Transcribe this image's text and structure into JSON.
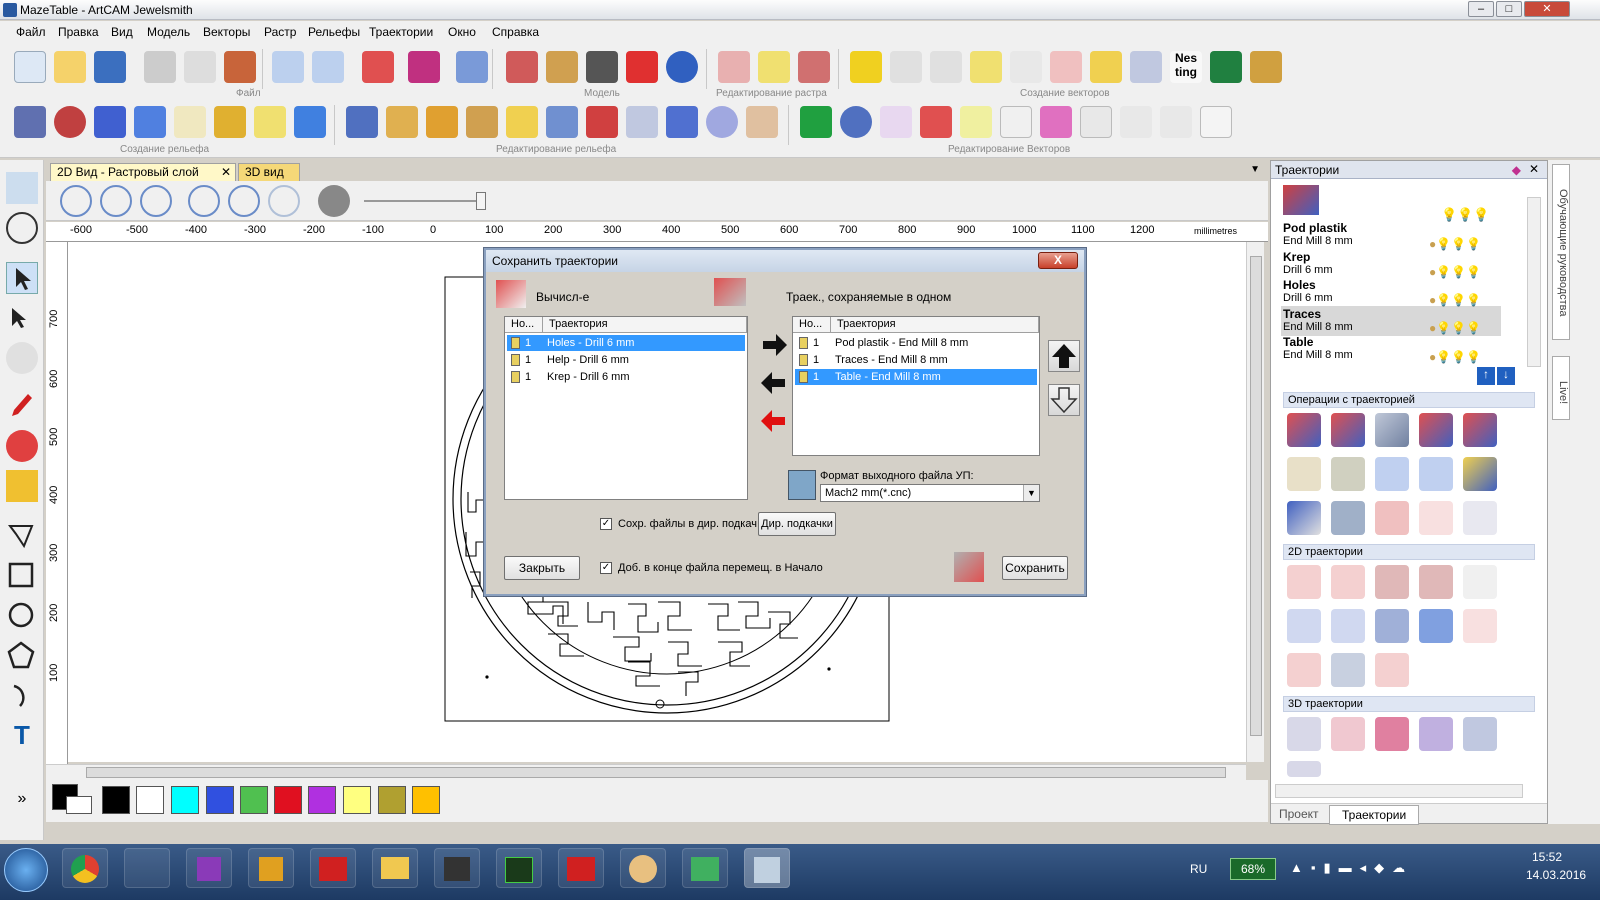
{
  "window": {
    "title": "MazeTable - ArtCAM Jewelsmith"
  },
  "menu": [
    "Файл",
    "Правка",
    "Вид",
    "Модель",
    "Векторы",
    "Растр",
    "Рельефы",
    "Траектории",
    "Окно",
    "Справка"
  ],
  "toolbar_groups": {
    "file": "Файл",
    "model": "Модель",
    "raster": "Редактирование растра",
    "vector_create": "Создание векторов",
    "relief_create": "Создание рельефа",
    "relief_edit": "Редактирование рельефа",
    "vector_edit": "Редактирование Векторов"
  },
  "tabs": [
    {
      "label": "2D Вид - Растровый слой",
      "active": true
    },
    {
      "label": "3D вид",
      "active": false
    }
  ],
  "ruler": {
    "ticks": [
      "-600",
      "-500",
      "-400",
      "-300",
      "-200",
      "-100",
      "0",
      "100",
      "200",
      "300",
      "400",
      "500",
      "600",
      "700",
      "800",
      "900",
      "1000",
      "1100",
      "1200"
    ],
    "unit": "millimetres",
    "vticks": [
      "700",
      "600",
      "500",
      "400",
      "300",
      "200",
      "100"
    ]
  },
  "palette": [
    "#000000",
    "#ffffff",
    "#00ffff",
    "#3050e0",
    "#50c050",
    "#e01020",
    "#b030e0",
    "#ffff80",
    "#b0a030",
    "#ffc000"
  ],
  "dialog": {
    "title": "Сохранить траектории",
    "left_label": "Вычисл-е",
    "right_label": "Траек., сохраняемые в одном",
    "col_no": "Но...",
    "col_name": "Траектория",
    "left_rows": [
      {
        "no": "1",
        "name": "Holes - Drill 6 mm",
        "selected": true
      },
      {
        "no": "1",
        "name": "Help - Drill 6 mm",
        "selected": false
      },
      {
        "no": "1",
        "name": "Krep - Drill 6 mm",
        "selected": false
      }
    ],
    "right_rows": [
      {
        "no": "1",
        "name": "Pod plastik - End Mill 8 mm",
        "selected": false
      },
      {
        "no": "1",
        "name": "Traces - End Mill 8 mm",
        "selected": false
      },
      {
        "no": "1",
        "name": "Table - End Mill 8 mm",
        "selected": true
      }
    ],
    "format_label": "Формат выходного файла УП:",
    "format_value": "Mach2 mm(*.cnc)",
    "chk_save_dir": "Сохр. файлы в дир. подкач",
    "dir_button": "Дир. подкачки",
    "chk_add_move": "Доб. в конце файла перемещ. в Начало",
    "close_button": "Закрыть",
    "save_button": "Сохранить",
    "close_x": "X"
  },
  "right_panel": {
    "title": "Траектории",
    "toolpaths": [
      {
        "name": "Pod plastik",
        "tool": "End Mill 8 mm"
      },
      {
        "name": "Krep",
        "tool": "Drill 6 mm"
      },
      {
        "name": "Holes",
        "tool": "Drill 6 mm"
      },
      {
        "name": "Traces",
        "tool": "End Mill 8 mm"
      },
      {
        "name": "Table",
        "tool": "End Mill 8 mm"
      }
    ],
    "sections": [
      "Операции с траекторией",
      "2D траектории",
      "3D траектории"
    ],
    "bottom_tabs": [
      "Проект",
      "Траектории"
    ],
    "side_tabs": [
      "Обучающие руководства",
      "Live!"
    ]
  },
  "taskbar": {
    "lang": "RU",
    "battery": "68%",
    "time": "15:52",
    "date": "14.03.2016"
  }
}
